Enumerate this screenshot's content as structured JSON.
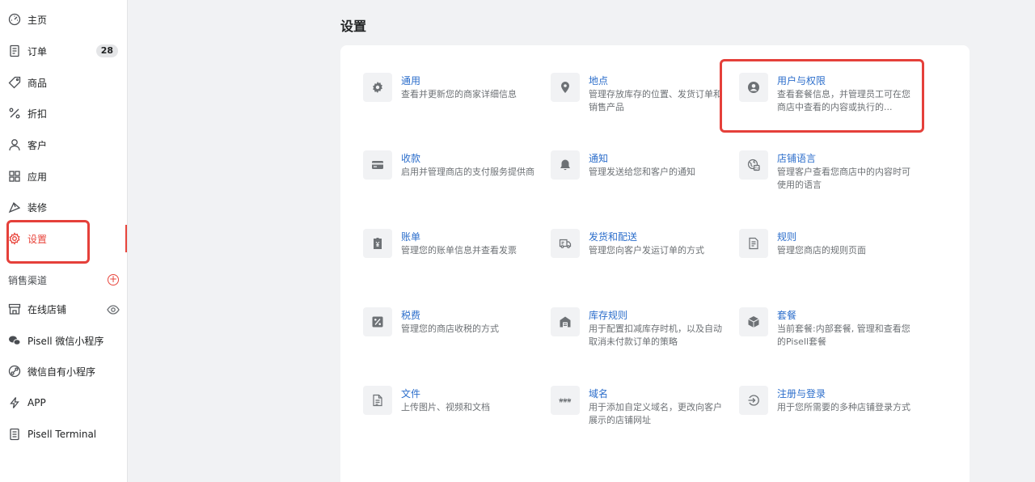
{
  "sidebar": {
    "items": [
      {
        "label": "主页",
        "icon": "dashboard-icon"
      },
      {
        "label": "订单",
        "icon": "orders-icon",
        "badge": "28"
      },
      {
        "label": "商品",
        "icon": "tag-icon"
      },
      {
        "label": "折扣",
        "icon": "percent-icon"
      },
      {
        "label": "客户",
        "icon": "person-icon"
      },
      {
        "label": "应用",
        "icon": "apps-icon"
      },
      {
        "label": "装修",
        "icon": "brush-icon"
      },
      {
        "label": "设置",
        "icon": "gear-icon"
      }
    ],
    "section_label": "销售渠道",
    "channels": [
      {
        "label": "在线店铺",
        "icon": "store-icon"
      },
      {
        "label": "Pisell 微信小程序",
        "icon": "wechat-icon"
      },
      {
        "label": "微信自有小程序",
        "icon": "link-icon"
      },
      {
        "label": "APP",
        "icon": "bolt-icon"
      },
      {
        "label": "Pisell Terminal",
        "icon": "terminal-icon"
      }
    ]
  },
  "main": {
    "title": "设置",
    "cards": [
      {
        "title": "通用",
        "desc": "查看并更新您的商家详细信息",
        "icon": "gear-icon"
      },
      {
        "title": "地点",
        "desc": "管理存放库存的位置、发货订单和销售产品",
        "icon": "location-pin-icon"
      },
      {
        "title": "用户与权限",
        "desc": "查看套餐信息，并管理员工可在您商店中查看的内容或执行的...",
        "icon": "user-circle-icon"
      },
      {
        "title": "收款",
        "desc": "启用并管理商店的支付服务提供商",
        "icon": "credit-card-icon"
      },
      {
        "title": "通知",
        "desc": "管理发送给您和客户的通知",
        "icon": "bell-icon"
      },
      {
        "title": "店铺语言",
        "desc": "管理客户查看您商店中的内容时可使用的语言",
        "icon": "language-globe-icon"
      },
      {
        "title": "账单",
        "desc": "管理您的账单信息并查看发票",
        "icon": "invoice-icon"
      },
      {
        "title": "发货和配送",
        "desc": "管理您向客户发运订单的方式",
        "icon": "truck-icon"
      },
      {
        "title": "规则",
        "desc": "管理您商店的规则页面",
        "icon": "document-icon"
      },
      {
        "title": "税费",
        "desc": "管理您的商店收税的方式",
        "icon": "percent-box-icon"
      },
      {
        "title": "库存规则",
        "desc": "用于配置扣减库存时机，以及自动取消未付款订单的策略",
        "icon": "warehouse-icon"
      },
      {
        "title": "套餐",
        "desc": "当前套餐:内部套餐, 管理和查看您的Pisell套餐",
        "icon": "package-icon"
      },
      {
        "title": "文件",
        "desc": "上传图片、视频和文档",
        "icon": "file-icon"
      },
      {
        "title": "域名",
        "desc": "用于添加自定义域名，更改向客户展示的店铺网址",
        "icon": "www-icon"
      },
      {
        "title": "注册与登录",
        "desc": "用于您所需要的多种店铺登录方式",
        "icon": "login-icon"
      }
    ]
  },
  "colors": {
    "accent_red": "#e8453c",
    "link_blue": "#2c6ecb",
    "highlight_box": "#e5403a"
  }
}
